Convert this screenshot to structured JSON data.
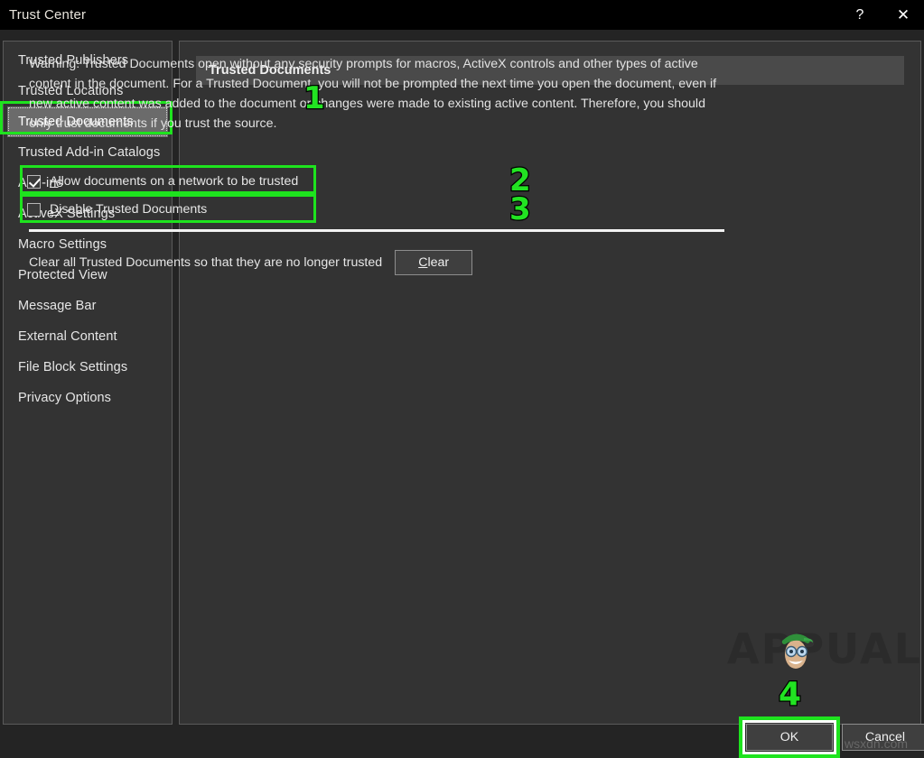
{
  "window": {
    "title": "Trust Center",
    "help_label": "?",
    "close_label": "✕"
  },
  "sidebar": {
    "items": [
      {
        "label": "Trusted Publishers",
        "selected": false
      },
      {
        "label": "Trusted Locations",
        "selected": false
      },
      {
        "label": "Trusted Documents",
        "selected": true
      },
      {
        "label": "Trusted Add-in Catalogs",
        "selected": false
      },
      {
        "label": "Add-ins",
        "selected": false
      },
      {
        "label": "ActiveX Settings",
        "selected": false
      },
      {
        "label": "Macro Settings",
        "selected": false
      },
      {
        "label": "Protected View",
        "selected": false
      },
      {
        "label": "Message Bar",
        "selected": false
      },
      {
        "label": "External Content",
        "selected": false
      },
      {
        "label": "File Block Settings",
        "selected": false
      },
      {
        "label": "Privacy Options",
        "selected": false
      }
    ]
  },
  "content": {
    "header": "Trusted Documents",
    "warning": "Warning: Trusted Documents open without any security prompts for macros, ActiveX controls and other types of active content in the document.  For a Trusted Document, you will not be prompted the next time you open the document, even if new active content was added to the document or changes were made to existing active content.  Therefore, you should only trust documents if you trust the source.",
    "checkbox_allow_network": {
      "label_prefix": "",
      "accel": "A",
      "label_rest": "llow documents on a network to be trusted",
      "checked": true
    },
    "checkbox_disable_trusted": {
      "label_prefix": "",
      "accel": "D",
      "label_rest": "isable Trusted Documents",
      "checked": false
    },
    "clear_text": "Clear all Trusted Documents so that they are no longer trusted",
    "clear_button": {
      "accel": "C",
      "label_rest": "lear"
    }
  },
  "footer": {
    "ok_label": "OK",
    "cancel_label": "Cancel"
  },
  "annotations": {
    "numbers": [
      "1",
      "2",
      "3",
      "4"
    ],
    "highlight_color": "#1ee31e"
  },
  "watermark": {
    "brand": "APPUALS",
    "site": "wsxdn.com"
  }
}
